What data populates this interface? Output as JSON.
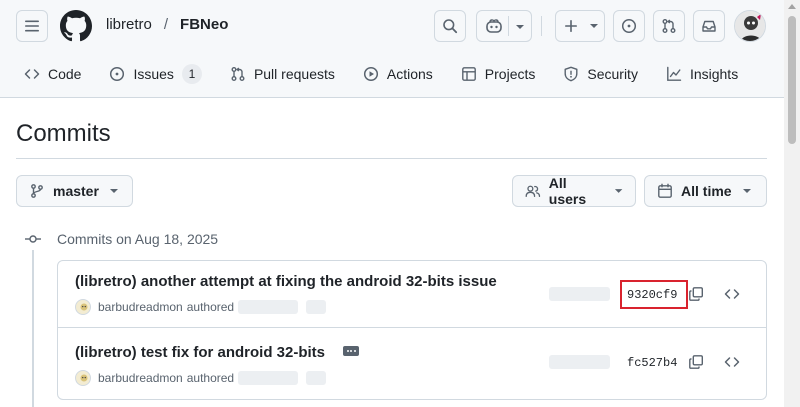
{
  "header": {
    "owner": "libretro",
    "separator": "/",
    "repo": "FBNeo"
  },
  "nav": [
    {
      "id": "code",
      "label": "Code",
      "icon": "code-icon"
    },
    {
      "id": "issues",
      "label": "Issues",
      "icon": "issue-icon",
      "count": "1"
    },
    {
      "id": "pull-requests",
      "label": "Pull requests",
      "icon": "git-pull-request-icon"
    },
    {
      "id": "actions",
      "label": "Actions",
      "icon": "play-icon"
    },
    {
      "id": "projects",
      "label": "Projects",
      "icon": "table-icon"
    },
    {
      "id": "security",
      "label": "Security",
      "icon": "shield-icon"
    },
    {
      "id": "insights",
      "label": "Insights",
      "icon": "graph-icon"
    }
  ],
  "page": {
    "title": "Commits",
    "branch": "master",
    "users_filter": "All users",
    "time_filter": "All time"
  },
  "timeline": {
    "heading": "Commits on Aug 18, 2025"
  },
  "commits": [
    {
      "title": "(libretro) another attempt at fixing the android 32-bits issue",
      "author": "barbudreadmon",
      "verb": "authored",
      "sha": "9320cf9",
      "highlighted": true
    },
    {
      "title": "(libretro) test fix for android 32-bits",
      "author": "barbudreadmon",
      "verb": "authored",
      "sha": "fc527b4",
      "highlighted": false,
      "has_more_button": true
    }
  ],
  "colors": {
    "text": "#1f2328",
    "muted": "#59636e",
    "border": "#d1d9e0",
    "header_bg": "#f6f8fa",
    "highlight": "#d9232e"
  }
}
